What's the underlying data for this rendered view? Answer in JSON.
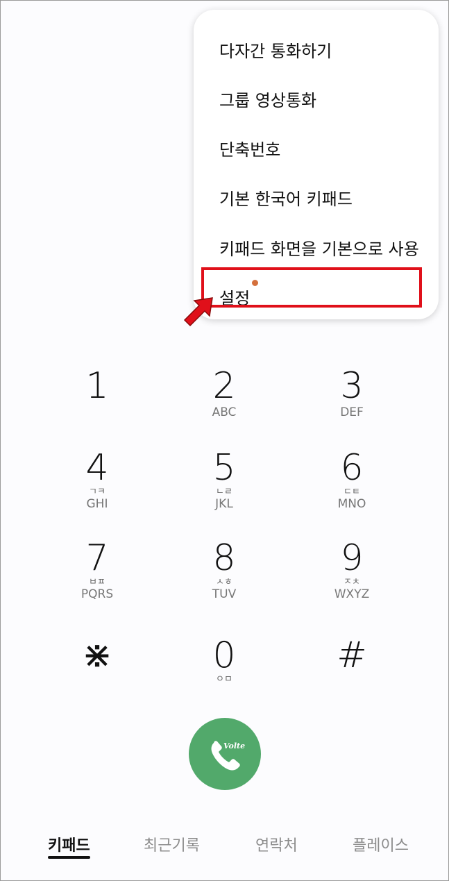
{
  "menu": {
    "items": [
      "다자간 통화하기",
      "그룹 영상통화",
      "단축번호",
      "기본 한국어 키패드",
      "키패드 화면을 기본으로 사용",
      "설정"
    ]
  },
  "keypad": {
    "keys": [
      {
        "digit": "1",
        "kor": "",
        "eng": ""
      },
      {
        "digit": "2",
        "kor": "",
        "eng": "ABC"
      },
      {
        "digit": "3",
        "kor": "",
        "eng": "DEF"
      },
      {
        "digit": "4",
        "kor": "ㄱㅋ",
        "eng": "GHI"
      },
      {
        "digit": "5",
        "kor": "ㄴㄹ",
        "eng": "JKL"
      },
      {
        "digit": "6",
        "kor": "ㄷㅌ",
        "eng": "MNO"
      },
      {
        "digit": "7",
        "kor": "ㅂㅍ",
        "eng": "PQRS"
      },
      {
        "digit": "8",
        "kor": "ㅅㅎ",
        "eng": "TUV"
      },
      {
        "digit": "9",
        "kor": "ㅈㅊ",
        "eng": "WXYZ"
      },
      {
        "digit": "⋇",
        "kor": "",
        "eng": ""
      },
      {
        "digit": "0",
        "kor": "ㅇㅁ",
        "eng": ""
      },
      {
        "digit": "#",
        "kor": "",
        "eng": ""
      }
    ]
  },
  "call": {
    "badge": "Volte",
    "icon": "phone-icon"
  },
  "tabs": [
    "키패드",
    "최근기록",
    "연락처",
    "플레이스"
  ],
  "colors": {
    "call_green": "#52a96b",
    "highlight_red": "#e0101a",
    "notification_dot": "#d4703c"
  }
}
